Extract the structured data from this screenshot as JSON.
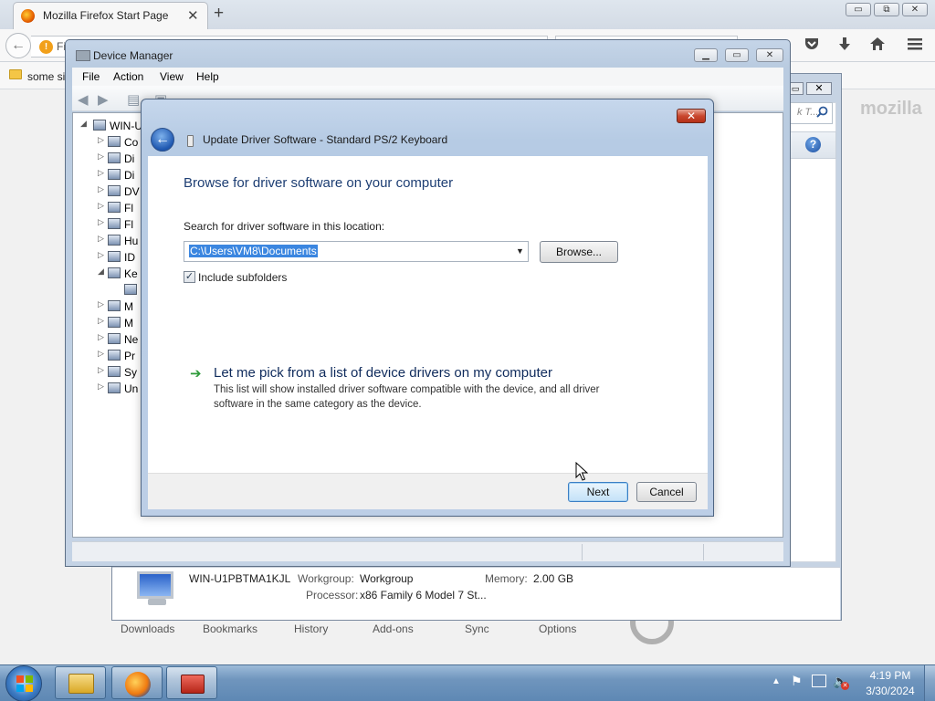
{
  "firefox": {
    "tab_title": "Mozilla Firefox Start Page",
    "tab_close": "✕",
    "new_tab": "+",
    "caption": {
      "minimize": "▭",
      "restore": "⧉",
      "close": "✕"
    },
    "url_partial": "Fi",
    "bookmark_partial": "some si",
    "brand": "mozilla",
    "bottom_items": [
      "Downloads",
      "Bookmarks",
      "History",
      "Add-ons",
      "Sync",
      "Options"
    ],
    "icons": [
      "back-icon",
      "pocket-icon",
      "download-icon",
      "home-icon",
      "menu-icon"
    ]
  },
  "bg_window": {
    "search_placeholder": "k T...",
    "help_glyph": "?",
    "computer_name": "WIN-U1PBTMA1KJL",
    "workgroup_label": "Workgroup:",
    "workgroup": "Workgroup",
    "memory_label": "Memory:",
    "memory": "2.00 GB",
    "processor_label": "Processor:",
    "processor": "x86 Family 6 Model 7 St..."
  },
  "device_manager": {
    "title": "Device Manager",
    "menus": [
      "File",
      "Action",
      "View",
      "Help"
    ],
    "tree_root": "WIN-U",
    "tree_items": [
      "Co",
      "Di",
      "Di",
      "DV",
      "Fl",
      "Fl",
      "Hu",
      "ID",
      "Ke",
      "M",
      "M",
      "Ne",
      "Pr",
      "Sy",
      "Un"
    ]
  },
  "dialog": {
    "title": "Update Driver Software - Standard PS/2 Keyboard",
    "heading": "Browse for driver software on your computer",
    "search_label": "Search for driver software in this location:",
    "path_value": "C:\\Users\\VM8\\Documents",
    "browse_label": "Browse...",
    "include_subfolders_label": "Include subfolders",
    "include_subfolders_checked": true,
    "pick_link": "Let me pick from a list of device drivers on my computer",
    "pick_desc_line1": "This list will show installed driver software compatible with the device, and all driver",
    "pick_desc_line2": "software in the same category as the device.",
    "next_label": "Next",
    "cancel_label": "Cancel",
    "close_glyph": "✕"
  },
  "taskbar": {
    "time": "4:19 PM",
    "date": "3/30/2024",
    "buttons": [
      "windows-explorer",
      "firefox",
      "device-manager"
    ]
  }
}
